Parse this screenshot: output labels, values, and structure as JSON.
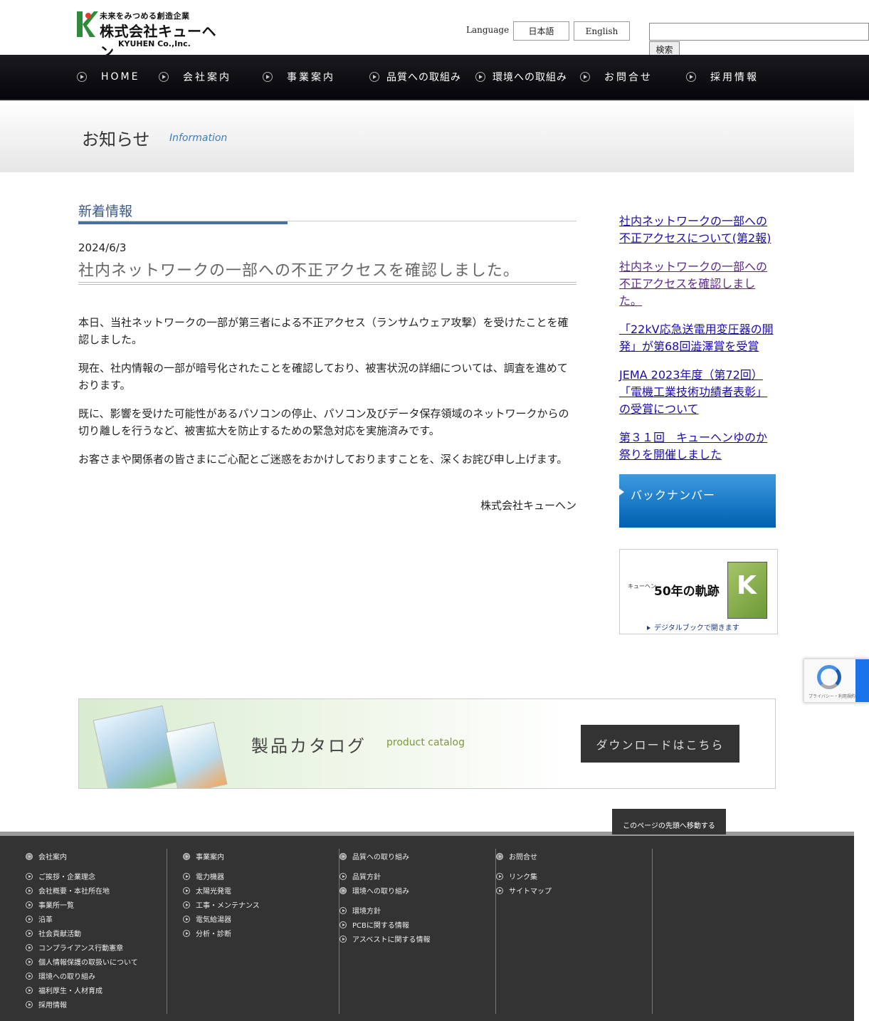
{
  "header": {
    "logo_tagline": "未来をみつめる創造企業",
    "logo_company": "株式会社キューヘン",
    "logo_english": "KYUHEN Co.,Inc.",
    "language_label": "Language",
    "lang_ja": "日本語",
    "lang_en": "English",
    "search_value": "",
    "search_button": "検索"
  },
  "nav": {
    "items": [
      "HOME",
      "会社案内",
      "事業案内",
      "品質への取組み",
      "環境への取組み",
      "お問合せ",
      "採用情報"
    ]
  },
  "banner": {
    "title": "お知らせ",
    "subtitle": "Information"
  },
  "main": {
    "section_heading": "新着情報",
    "date": "2024/6/3",
    "title": "社内ネットワークの一部への不正アクセスを確認しました。",
    "paragraphs": [
      "本日、当社ネットワークの一部が第三者による不正アクセス（ランサムウェア攻撃）を受けたことを確認しました。",
      "現在、社内情報の一部が暗号化されたことを確認しており、被害状況の詳細については、調査を進めております。",
      "既に、影響を受けた可能性があるパソコンの停止、パソコン及びデータ保存領域のネットワークからの切り離しを行うなど、被害拡大を防止するための緊急対応を実施済みです。",
      "お客さまや関係者の皆さまにご心配とご迷惑をおかけしておりますことを、深くお詫び申し上げます。"
    ],
    "signature": "株式会社キューヘン"
  },
  "sidebar": {
    "links": [
      "社内ネットワークの一部への不正アクセスについて(第2報)",
      "社内ネットワークの一部への不正アクセスを確認しました。",
      "「22kV応急送電用変圧器の開発」が第68回澁澤賞を受賞",
      "JEMA 2023年度（第72回）「電機工業技術功績者表彰」の受賞について",
      "第３１回　キューヘンゆのか祭りを開催しました"
    ],
    "backnumber": "バックナンバー",
    "history_small": "キューヘン",
    "history_big": "50年の軌跡",
    "history_caption": "デジタルブックで開きます"
  },
  "recaptcha": {
    "privacy": "プライバシー・利用規約"
  },
  "catalog": {
    "title": "製品カタログ",
    "subtitle": "product catalog",
    "button": "ダウンロードはこちら"
  },
  "pagetop": "このページの先頭へ移動する",
  "footer": {
    "columns": [
      {
        "head": "会社案内",
        "items": [
          "ご挨拶・企業理念",
          "会社概要・本社所在地",
          "事業所一覧",
          "沿革",
          "社会貢献活動",
          "コンプライアンス行動憲章",
          "個人情報保護の取扱いについて",
          "環境への取り組み",
          "福利厚生・人材育成",
          "採用情報"
        ]
      },
      {
        "head": "事業案内",
        "items": [
          "電力機器",
          "太陽光発電",
          "工事・メンテナンス",
          "電気給湯器",
          "分析・診断"
        ]
      },
      {
        "head": "品質への取り組み",
        "items": [
          "品質方針",
          "環境への取り組み",
          "環境方針",
          "PCBに関する情報",
          "アスベストに関する情報"
        ]
      },
      {
        "head": "お問合せ",
        "items": [
          "リンク集",
          "サイトマップ"
        ]
      }
    ]
  }
}
